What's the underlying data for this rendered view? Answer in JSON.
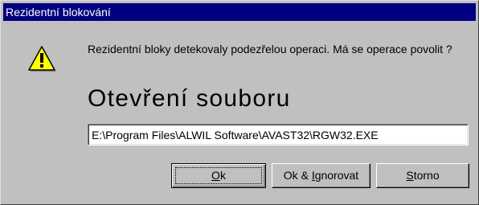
{
  "window": {
    "title": "Rezidentní blokování"
  },
  "dialog": {
    "icon": "warning-icon",
    "message": "Rezidentní bloky detekovaly podezřelou operaci. Má se operace povolit ?",
    "operation": "Otevření souboru",
    "file_path": "E:\\Program Files\\ALWIL Software\\AVAST32\\RGW32.EXE"
  },
  "buttons": {
    "ok": {
      "label": "Ok",
      "accel": "O",
      "rest": "k"
    },
    "ok_ignore": {
      "label": "Ok & Ignorovat",
      "pre": "Ok & ",
      "accel": "I",
      "rest": "gnorovat"
    },
    "storno": {
      "label": "Storno",
      "accel": "S",
      "rest": "torno"
    }
  },
  "colors": {
    "titlebar": "#000080",
    "face": "#c0c0c0",
    "icon_fill": "#ffff00"
  }
}
